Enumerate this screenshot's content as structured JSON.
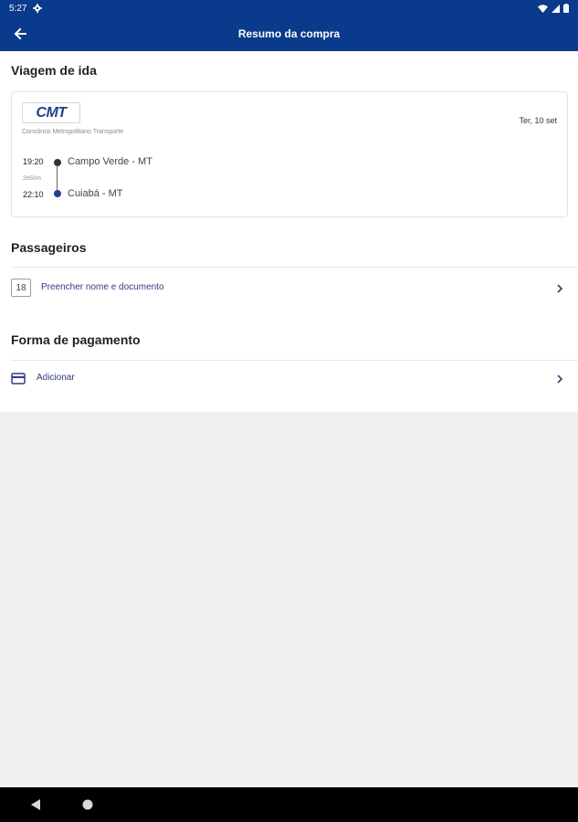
{
  "status_bar": {
    "time": "5:27"
  },
  "header": {
    "title": "Resumo da compra"
  },
  "trip": {
    "section_title": "Viagem de ida",
    "company_logo_text": "CMT",
    "company_name": "Consórcio Metropolitano Transporte",
    "date": "Ter, 10 set",
    "departure_time": "19:20",
    "duration": "2h50m",
    "arrival_time": "22:10",
    "origin": "Campo Verde - MT",
    "destination": "Cuiabá - MT"
  },
  "passengers": {
    "section_title": "Passageiros",
    "age_badge": "18",
    "fill_label": "Preencher nome e documento"
  },
  "payment": {
    "section_title": "Forma de pagamento",
    "add_label": "Adicionar"
  },
  "colors": {
    "brand": "#0a3a8c",
    "link": "#2f3a8f",
    "destination_dot": "#1f3f9a",
    "background": "#f0f0f2"
  },
  "icons": [
    "settings-icon",
    "wifi-icon",
    "signal-icon",
    "battery-icon",
    "back-arrow-icon",
    "chevron-right-icon",
    "credit-card-icon",
    "nav-back-icon",
    "nav-home-icon"
  ]
}
